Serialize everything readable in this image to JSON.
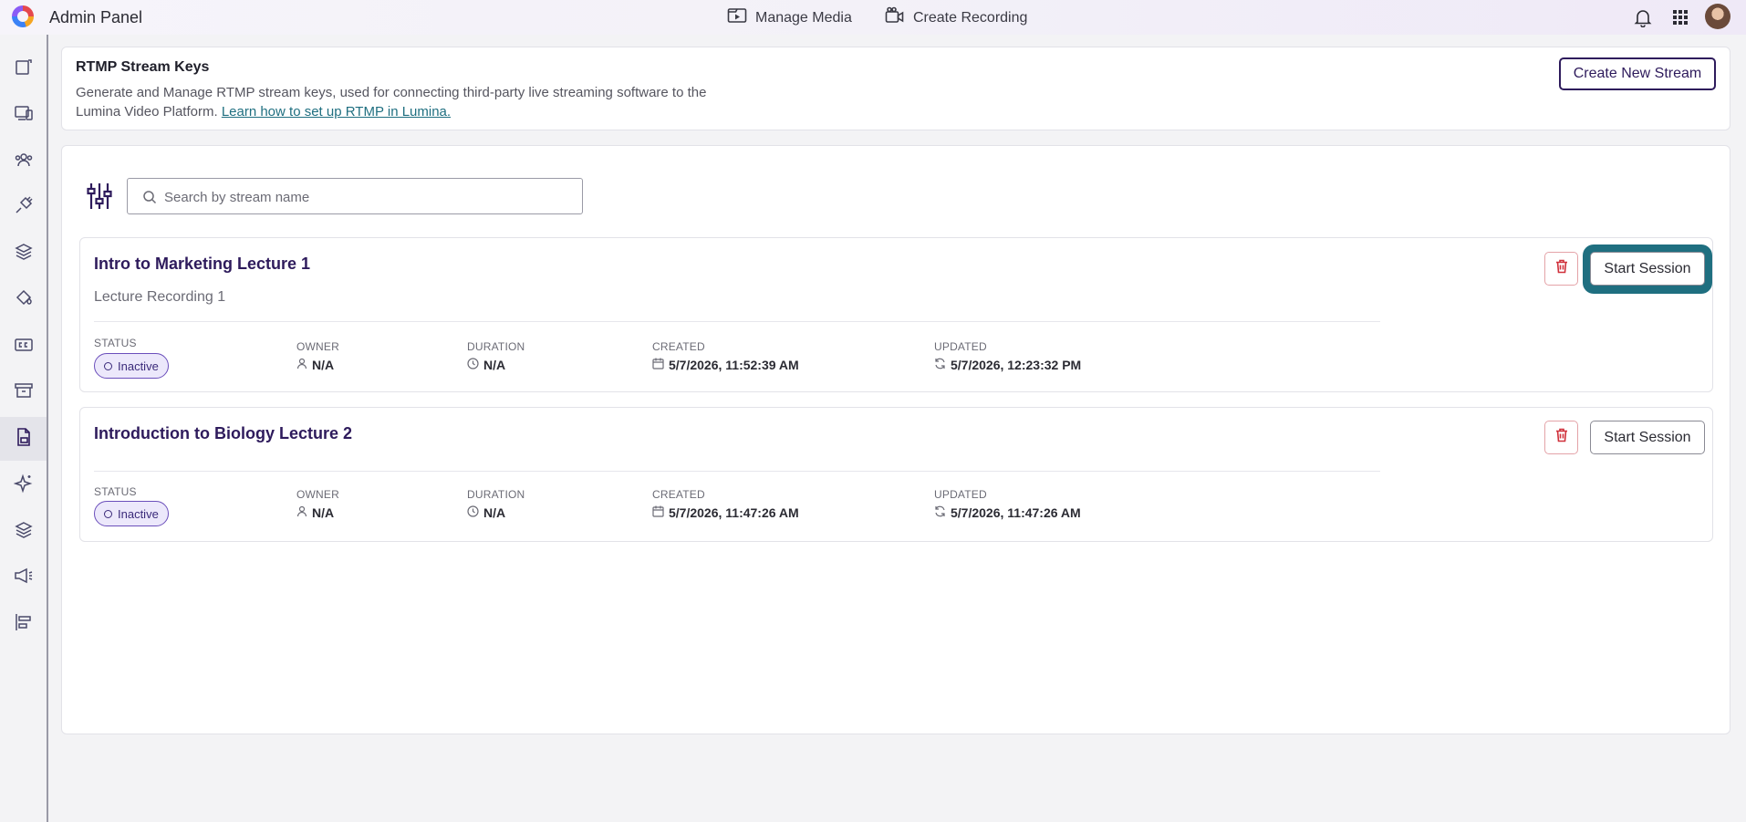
{
  "app": {
    "title": "Admin Panel"
  },
  "top_nav": {
    "manage_media": "Manage Media",
    "create_recording": "Create Recording"
  },
  "sidebar": {
    "items": [
      {
        "name": "sidebar-item-dashboard",
        "icon": "document-icon"
      },
      {
        "name": "sidebar-item-devices",
        "icon": "devices-icon"
      },
      {
        "name": "sidebar-item-users",
        "icon": "users-icon"
      },
      {
        "name": "sidebar-item-integrations",
        "icon": "plug-icon"
      },
      {
        "name": "sidebar-item-layers",
        "icon": "layers-icon"
      },
      {
        "name": "sidebar-item-branding",
        "icon": "paint-bucket-icon"
      },
      {
        "name": "sidebar-item-captions",
        "icon": "closed-captions-icon"
      },
      {
        "name": "sidebar-item-archive",
        "icon": "archive-icon"
      },
      {
        "name": "sidebar-item-rtmp",
        "icon": "file-stream-icon",
        "active": true
      },
      {
        "name": "sidebar-item-ai",
        "icon": "sparkles-icon"
      },
      {
        "name": "sidebar-item-collections",
        "icon": "layers-icon"
      },
      {
        "name": "sidebar-item-live",
        "icon": "megaphone-icon"
      },
      {
        "name": "sidebar-item-reports",
        "icon": "align-left-icon"
      }
    ]
  },
  "header": {
    "title": "RTMP Stream Keys",
    "description": "Generate and Manage RTMP stream keys, used for connecting third-party live streaming software to the Lumina Video Platform.",
    "link_text": "Learn how to set up RTMP in Lumina.",
    "create_button": "Create New Stream"
  },
  "search": {
    "placeholder": "Search by stream name",
    "value": ""
  },
  "labels": {
    "status": "STATUS",
    "owner": "OWNER",
    "duration": "DURATION",
    "created": "CREATED",
    "updated": "UPDATED",
    "start_session": "Start Session"
  },
  "streams": [
    {
      "title": "Intro to Marketing Lecture 1",
      "subtitle": "Lecture Recording 1",
      "status": "Inactive",
      "owner": "N/A",
      "duration": "N/A",
      "created": "5/7/2026, 11:52:39 AM",
      "updated": "5/7/2026, 12:23:32 PM"
    },
    {
      "title": "Introduction to Biology Lecture 2",
      "subtitle": "",
      "status": "Inactive",
      "owner": "N/A",
      "duration": "N/A",
      "created": "5/7/2026, 11:47:26 AM",
      "updated": "5/7/2026, 11:47:26 AM"
    }
  ],
  "colors": {
    "brand_dark": "#2e1b5c",
    "focus_ring": "#1f6f80",
    "danger": "#d0313b",
    "badge_bg": "#ece8fb"
  }
}
